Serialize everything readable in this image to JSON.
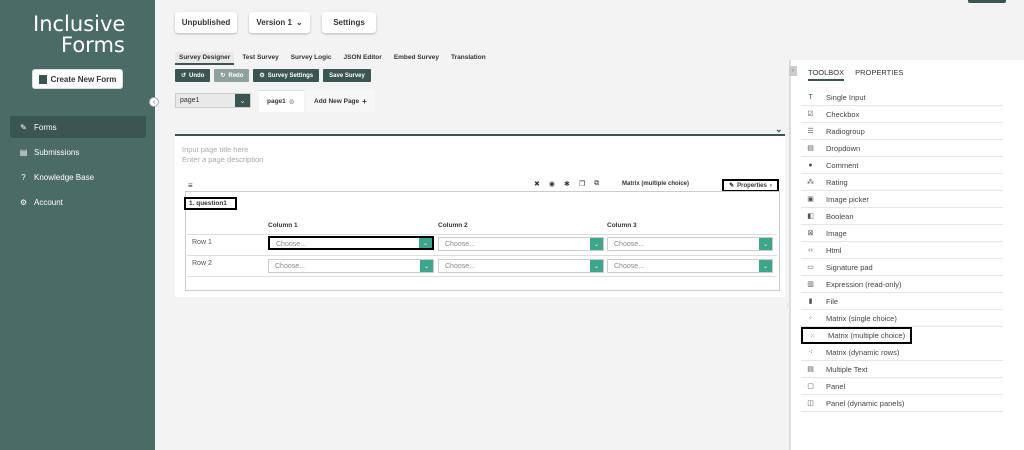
{
  "sidebar": {
    "logo_line1": "Inclusive",
    "logo_line2": "Forms",
    "create_button": "Create New Form",
    "nav": [
      {
        "label": "Forms",
        "icon": "edit-icon"
      },
      {
        "label": "Submissions",
        "icon": "document-icon"
      },
      {
        "label": "Knowledge Base",
        "icon": "help-circle-icon"
      },
      {
        "label": "Account",
        "icon": "gear-icon"
      }
    ]
  },
  "header": {
    "status_button": "Unpublished",
    "version_button": "Version 1",
    "settings_button": "Settings"
  },
  "tabs": [
    "Survey Designer",
    "Test Survey",
    "Survey Logic",
    "JSON Editor",
    "Embed Survey",
    "Translation"
  ],
  "toolbar": {
    "undo": "Undo",
    "redo": "Redo",
    "survey_settings": "Survey Settings",
    "save_survey": "Save Survey"
  },
  "pages": {
    "selected": "page1",
    "active_tab": "page1",
    "add_new_page": "Add New Page"
  },
  "canvas": {
    "title_placeholder": "Input page title here",
    "desc_placeholder": "Enter a page description",
    "question_type": "Matrix (multiple choice)",
    "properties_button": "Properties",
    "question_title": "1. question1",
    "columns": [
      "Column 1",
      "Column 2",
      "Column 3"
    ],
    "rows": [
      "Row 1",
      "Row 2"
    ],
    "select_placeholder": "Choose..."
  },
  "right_panel": {
    "tab_toolbox": "TOOLBOX",
    "tab_properties": "PROPERTIES",
    "items": [
      {
        "label": "Single Input",
        "glyph": "T"
      },
      {
        "label": "Checkbox",
        "glyph": "☑"
      },
      {
        "label": "Radiogroup",
        "glyph": "☰"
      },
      {
        "label": "Dropdown",
        "glyph": "▤"
      },
      {
        "label": "Comment",
        "glyph": "●"
      },
      {
        "label": "Rating",
        "glyph": "⁂"
      },
      {
        "label": "Image picker",
        "glyph": "▣"
      },
      {
        "label": "Boolean",
        "glyph": "◧"
      },
      {
        "label": "Image",
        "glyph": "⊠"
      },
      {
        "label": "Html",
        "glyph": "‹›"
      },
      {
        "label": "Signature pad",
        "glyph": "▭"
      },
      {
        "label": "Expression (read-only)",
        "glyph": "▥"
      },
      {
        "label": "File",
        "glyph": "▮"
      },
      {
        "label": "Matrix (single choice)",
        "glyph": "⁘"
      },
      {
        "label": "Matrix (multiple choice)",
        "glyph": "⁙"
      },
      {
        "label": "Matrix (dynamic rows)",
        "glyph": "⁖"
      },
      {
        "label": "Multiple Text",
        "glyph": "▤"
      },
      {
        "label": "Panel",
        "glyph": "▢"
      },
      {
        "label": "Panel (dynamic panels)",
        "glyph": "◫"
      }
    ]
  }
}
